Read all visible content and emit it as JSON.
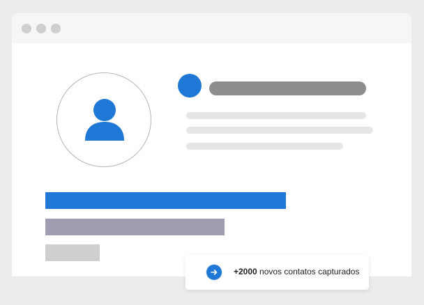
{
  "colors": {
    "accent": "#1f78d6",
    "bar_primary": "#1f78d6",
    "bar_secondary": "#a19db1",
    "bar_tertiary": "#cfcfcf"
  },
  "window": {
    "controls": [
      "window-dot",
      "window-dot",
      "window-dot"
    ]
  },
  "profile": {
    "avatar_icon": "user-icon"
  },
  "toast": {
    "icon": "arrow-right-icon",
    "count": "+2000",
    "message": " novos contatos capturados"
  }
}
